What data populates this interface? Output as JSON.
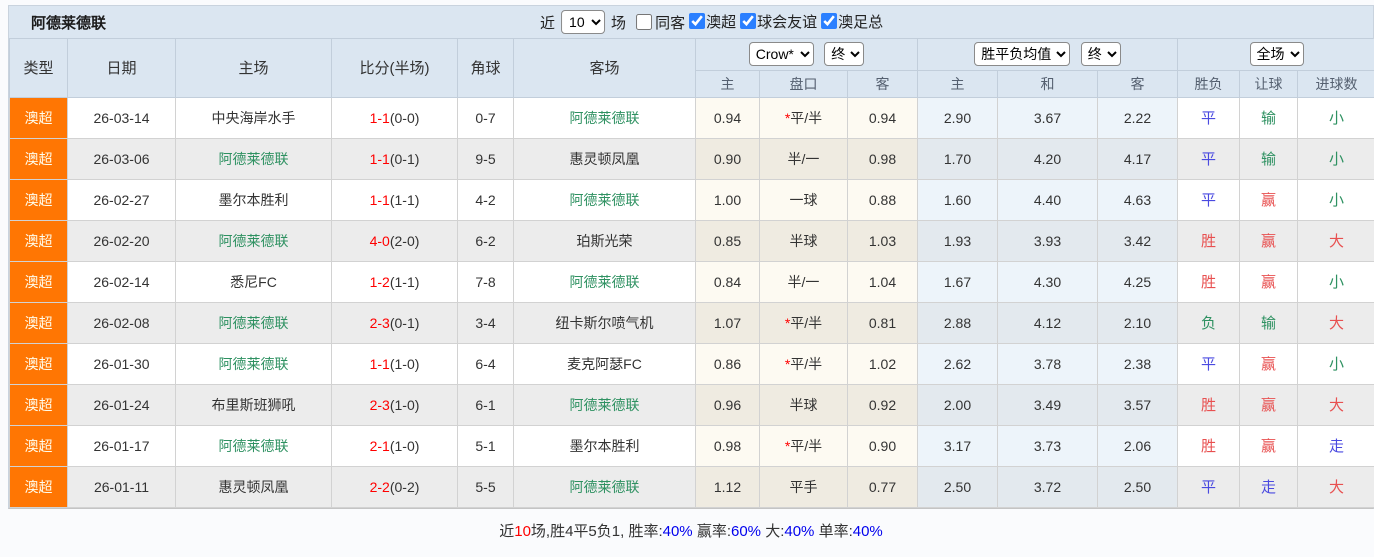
{
  "toolbar": {
    "title": "阿德莱德联",
    "near_label": "近",
    "matches_count": "10",
    "matches_label": "场",
    "same_venue_label": "同客",
    "same_venue_checked": false,
    "filters": [
      {
        "label": "澳超",
        "checked": true
      },
      {
        "label": "球会友谊",
        "checked": true
      },
      {
        "label": "澳足总",
        "checked": true
      }
    ]
  },
  "table": {
    "static_headers": [
      "类型",
      "日期",
      "主场",
      "比分(半场)",
      "角球",
      "客场"
    ],
    "odds_group": {
      "select1": "Crow*",
      "select2": "终",
      "cols": [
        "主",
        "盘口",
        "客"
      ]
    },
    "mean_group": {
      "select1": "胜平负均值",
      "select2": "终",
      "cols": [
        "主",
        "和",
        "客"
      ]
    },
    "result_group": {
      "select": "全场",
      "cols": [
        "胜负",
        "让球",
        "进球数"
      ]
    },
    "rows": [
      {
        "league": "澳超",
        "date": "26-03-14",
        "home": "中央海岸水手",
        "home_target": false,
        "score": "1-1",
        "half": "(0-0)",
        "corner": "0-7",
        "away": "阿德莱德联",
        "away_target": true,
        "odds_home": "0.94",
        "handicap": "平/半",
        "handicap_star": true,
        "odds_away": "0.94",
        "avg_home": "2.90",
        "avg_draw": "3.67",
        "avg_away": "2.22",
        "result_wdl": {
          "text": "平",
          "color": "blue"
        },
        "result_handicap": {
          "text": "输",
          "color": "green"
        },
        "result_goals": {
          "text": "小",
          "color": "green"
        }
      },
      {
        "league": "澳超",
        "date": "26-03-06",
        "home": "阿德莱德联",
        "home_target": true,
        "score": "1-1",
        "half": "(0-1)",
        "corner": "9-5",
        "away": "惠灵顿凤凰",
        "away_target": false,
        "odds_home": "0.90",
        "handicap": "半/一",
        "handicap_star": false,
        "odds_away": "0.98",
        "avg_home": "1.70",
        "avg_draw": "4.20",
        "avg_away": "4.17",
        "result_wdl": {
          "text": "平",
          "color": "blue"
        },
        "result_handicap": {
          "text": "输",
          "color": "green"
        },
        "result_goals": {
          "text": "小",
          "color": "green"
        }
      },
      {
        "league": "澳超",
        "date": "26-02-27",
        "home": "墨尔本胜利",
        "home_target": false,
        "score": "1-1",
        "half": "(1-1)",
        "corner": "4-2",
        "away": "阿德莱德联",
        "away_target": true,
        "odds_home": "1.00",
        "handicap": "一球",
        "handicap_star": false,
        "odds_away": "0.88",
        "avg_home": "1.60",
        "avg_draw": "4.40",
        "avg_away": "4.63",
        "result_wdl": {
          "text": "平",
          "color": "blue"
        },
        "result_handicap": {
          "text": "赢",
          "color": "red"
        },
        "result_goals": {
          "text": "小",
          "color": "green"
        }
      },
      {
        "league": "澳超",
        "date": "26-02-20",
        "home": "阿德莱德联",
        "home_target": true,
        "score": "4-0",
        "half": "(2-0)",
        "corner": "6-2",
        "away": "珀斯光荣",
        "away_target": false,
        "odds_home": "0.85",
        "handicap": "半球",
        "handicap_star": false,
        "odds_away": "1.03",
        "avg_home": "1.93",
        "avg_draw": "3.93",
        "avg_away": "3.42",
        "result_wdl": {
          "text": "胜",
          "color": "red"
        },
        "result_handicap": {
          "text": "赢",
          "color": "red"
        },
        "result_goals": {
          "text": "大",
          "color": "red"
        }
      },
      {
        "league": "澳超",
        "date": "26-02-14",
        "home": "悉尼FC",
        "home_target": false,
        "score": "1-2",
        "half": "(1-1)",
        "corner": "7-8",
        "away": "阿德莱德联",
        "away_target": true,
        "odds_home": "0.84",
        "handicap": "半/一",
        "handicap_star": false,
        "odds_away": "1.04",
        "avg_home": "1.67",
        "avg_draw": "4.30",
        "avg_away": "4.25",
        "result_wdl": {
          "text": "胜",
          "color": "red"
        },
        "result_handicap": {
          "text": "赢",
          "color": "red"
        },
        "result_goals": {
          "text": "小",
          "color": "green"
        }
      },
      {
        "league": "澳超",
        "date": "26-02-08",
        "home": "阿德莱德联",
        "home_target": true,
        "score": "2-3",
        "half": "(0-1)",
        "corner": "3-4",
        "away": "纽卡斯尔喷气机",
        "away_target": false,
        "odds_home": "1.07",
        "handicap": "平/半",
        "handicap_star": true,
        "odds_away": "0.81",
        "avg_home": "2.88",
        "avg_draw": "4.12",
        "avg_away": "2.10",
        "result_wdl": {
          "text": "负",
          "color": "green"
        },
        "result_handicap": {
          "text": "输",
          "color": "green"
        },
        "result_goals": {
          "text": "大",
          "color": "red"
        }
      },
      {
        "league": "澳超",
        "date": "26-01-30",
        "home": "阿德莱德联",
        "home_target": true,
        "score": "1-1",
        "half": "(1-0)",
        "corner": "6-4",
        "away": "麦克阿瑟FC",
        "away_target": false,
        "odds_home": "0.86",
        "handicap": "平/半",
        "handicap_star": true,
        "odds_away": "1.02",
        "avg_home": "2.62",
        "avg_draw": "3.78",
        "avg_away": "2.38",
        "result_wdl": {
          "text": "平",
          "color": "blue"
        },
        "result_handicap": {
          "text": "赢",
          "color": "red"
        },
        "result_goals": {
          "text": "小",
          "color": "green"
        }
      },
      {
        "league": "澳超",
        "date": "26-01-24",
        "home": "布里斯班狮吼",
        "home_target": false,
        "score": "2-3",
        "half": "(1-0)",
        "corner": "6-1",
        "away": "阿德莱德联",
        "away_target": true,
        "odds_home": "0.96",
        "handicap": "半球",
        "handicap_star": false,
        "odds_away": "0.92",
        "avg_home": "2.00",
        "avg_draw": "3.49",
        "avg_away": "3.57",
        "result_wdl": {
          "text": "胜",
          "color": "red"
        },
        "result_handicap": {
          "text": "赢",
          "color": "red"
        },
        "result_goals": {
          "text": "大",
          "color": "red"
        }
      },
      {
        "league": "澳超",
        "date": "26-01-17",
        "home": "阿德莱德联",
        "home_target": true,
        "score": "2-1",
        "half": "(1-0)",
        "corner": "5-1",
        "away": "墨尔本胜利",
        "away_target": false,
        "odds_home": "0.98",
        "handicap": "平/半",
        "handicap_star": true,
        "odds_away": "0.90",
        "avg_home": "3.17",
        "avg_draw": "3.73",
        "avg_away": "2.06",
        "result_wdl": {
          "text": "胜",
          "color": "red"
        },
        "result_handicap": {
          "text": "赢",
          "color": "red"
        },
        "result_goals": {
          "text": "走",
          "color": "blue"
        }
      },
      {
        "league": "澳超",
        "date": "26-01-11",
        "home": "惠灵顿凤凰",
        "home_target": false,
        "score": "2-2",
        "half": "(0-2)",
        "corner": "5-5",
        "away": "阿德莱德联",
        "away_target": true,
        "odds_home": "1.12",
        "handicap": "平手",
        "handicap_star": false,
        "odds_away": "0.77",
        "avg_home": "2.50",
        "avg_draw": "3.72",
        "avg_away": "2.50",
        "result_wdl": {
          "text": "平",
          "color": "blue"
        },
        "result_handicap": {
          "text": "走",
          "color": "blue"
        },
        "result_goals": {
          "text": "大",
          "color": "red"
        }
      }
    ]
  },
  "summary": {
    "segments": [
      {
        "text": "近",
        "color": "k"
      },
      {
        "text": "10",
        "color": "r"
      },
      {
        "text": "场,胜4平5负1, 胜率:",
        "color": "k"
      },
      {
        "text": "40%",
        "color": "b"
      },
      {
        "text": " 赢率:",
        "color": "k"
      },
      {
        "text": "60%",
        "color": "b"
      },
      {
        "text": " 大:",
        "color": "k"
      },
      {
        "text": "40%",
        "color": "b"
      },
      {
        "text": " 单率:",
        "color": "k"
      },
      {
        "text": "40%",
        "color": "b"
      }
    ]
  },
  "colors": {
    "league_badge_orange": "#ff7603",
    "target_team_green": "#2e9161",
    "score_red": "#ff0000",
    "result_red": "#e85050",
    "result_blue": "#4a4ae0",
    "summary_blue": "#0000ee",
    "header_bg": "#dbe6f1"
  }
}
